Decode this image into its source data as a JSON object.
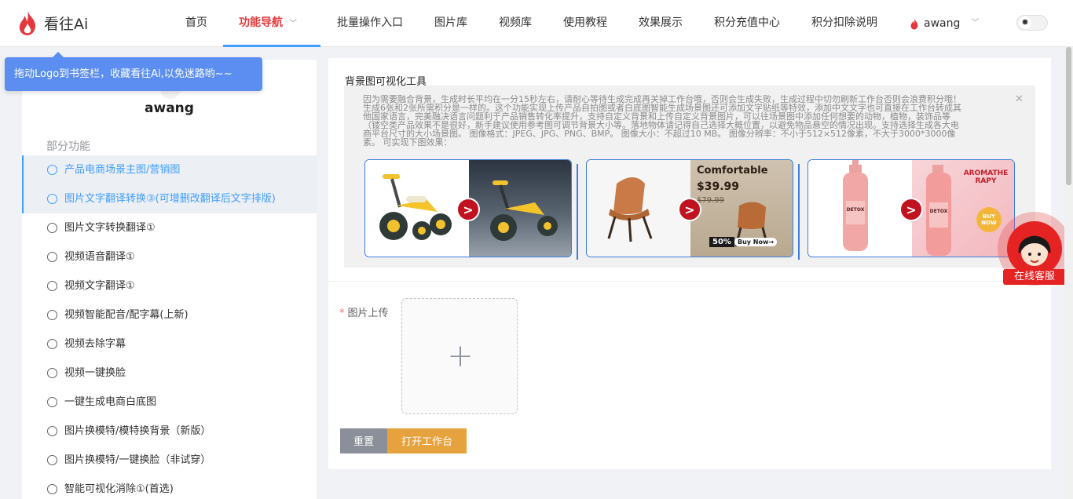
{
  "app": {
    "brand": "看往Ai",
    "logo_icon": "flame-logo-icon",
    "accent": "#e4393c"
  },
  "nav": {
    "items": [
      {
        "label": "首页"
      },
      {
        "label": "功能导航",
        "active": true
      },
      {
        "label": "批量操作入口"
      },
      {
        "label": "图片库"
      },
      {
        "label": "视频库"
      },
      {
        "label": "使用教程"
      },
      {
        "label": "效果展示"
      },
      {
        "label": "积分充值中心"
      },
      {
        "label": "积分扣除说明"
      }
    ],
    "dropdown_icon": "chevron-down-icon",
    "user": "awang"
  },
  "tooltip": {
    "text": "拖动Logo到书签栏，收藏看往Ai,以免迷路哟~~"
  },
  "sidebar": {
    "username": "awang",
    "section_title": "部分功能",
    "items": [
      {
        "label": "产品电商场景主图/营销图",
        "selected": true
      },
      {
        "label": "图片文字翻译转换③(可增删改翻译后文字排版)",
        "selected": true
      },
      {
        "label": "图片文字转换翻译①"
      },
      {
        "label": "视频语音翻译①"
      },
      {
        "label": "视频文字翻译①"
      },
      {
        "label": "视频智能配音/配字幕(上新)"
      },
      {
        "label": "视频去除字幕"
      },
      {
        "label": "视频一键换脸"
      },
      {
        "label": "一键生成电商白底图"
      },
      {
        "label": "图片换模特/模特换背景（新版）"
      },
      {
        "label": "图片换模特/一键换脸（非试穿）"
      },
      {
        "label": "智能可视化消除①(首选)"
      }
    ]
  },
  "main": {
    "tool_title": "背景图可视化工具",
    "info_lines": [
      "因为需要融合背景，生成时长平均在一分15秒左右，请耐心等待生成完成再关掉工作台哦，否则会生成失败，生成过程中切勿刷新工作台否则会浪费积分哦！",
      "生成6张和2张所需积分是一样的。这个功能实现上传产品自拍图或者白底图智能生成场景图还可添加文字贴纸等特效，添加中文文字也可直接在工作台转成其",
      "他国家语言，完美融决语言问题利于产品销售转化率提升，支持自定义背景和上传自定义背景图片，可以往场景图中添加任何想要的动物，植物，装饰品等",
      "（镂空类产品效果不是很好，新手建议使用参考图可调节背景大小等。落地物体请记得自己选择大概位置，以避免物品悬空的情况出现。支持选择生成各大电",
      "商平台尺寸的大小场景图。 图像格式：JPEG、JPG、PNG、BMP。 图像大小：不超过10 MB。 图像分辨率：不小于512×512像素，不大于3000*3000像",
      "素。 可实现下图效果："
    ],
    "examples": [
      {
        "name": "tricycle",
        "overlay": ""
      },
      {
        "name": "chair",
        "overlay_title": "Comfortable",
        "price": "$39.99",
        "old_price": "$79.99",
        "badge": "50%",
        "cta": "Buy Now→"
      },
      {
        "name": "bottle",
        "overlay_title": "AROMATHE RAPY",
        "badge": "BUY NOW",
        "bottle_text": "DETOX"
      }
    ],
    "upload_label": "图片上传",
    "upload_icon": "plus-icon",
    "reset_label": "重置",
    "open_label": "打开工作台"
  },
  "customer_service": {
    "label": "在线客服"
  }
}
